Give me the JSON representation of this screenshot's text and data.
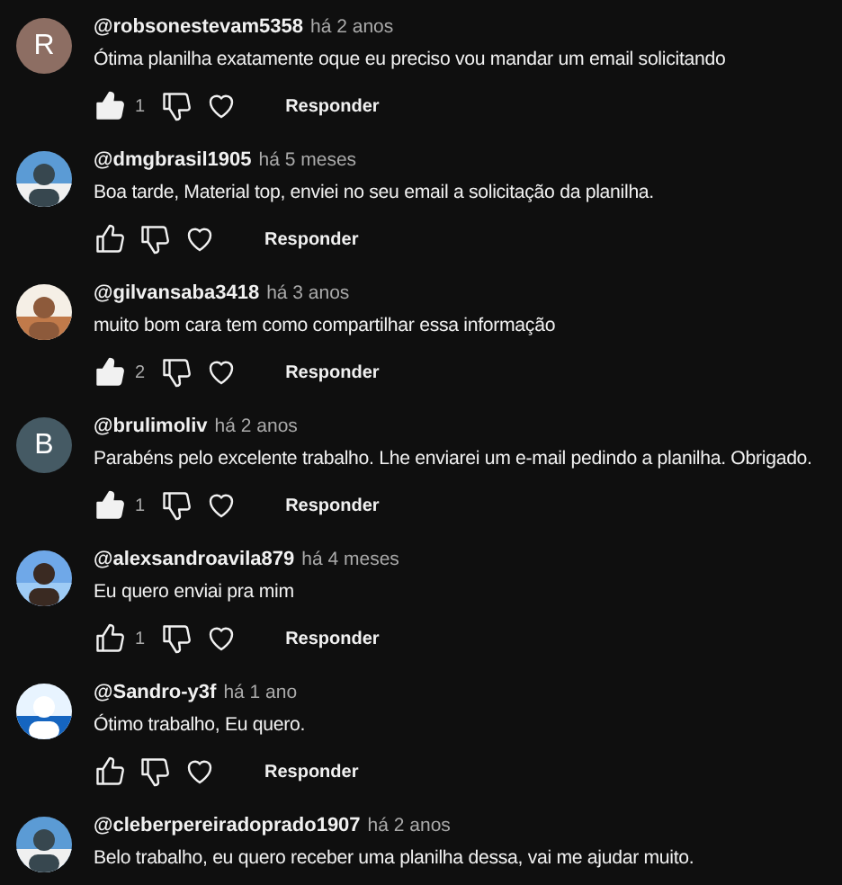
{
  "comments": [
    {
      "avatar": {
        "kind": "letter",
        "letter": "R",
        "color": "#8d6e63"
      },
      "author": "@robsonestevam5358",
      "time": "há 2 anos",
      "text": "Ótima planilha exatamente oque eu preciso vou mandar um email solicitando",
      "liked": true,
      "likes": "1",
      "reply": "Responder"
    },
    {
      "author": "@dmgbrasil1905",
      "time": "há 5 meses",
      "text": "Boa tarde, Material top, enviei no seu email a solicitação da planilha.",
      "liked": false,
      "reply": "Responder"
    },
    {
      "author": "@gilvansaba3418",
      "time": "há 3 anos",
      "text": "muito bom cara  tem como compartilhar essa informação",
      "liked": true,
      "likes": "2",
      "reply": "Responder"
    },
    {
      "avatar": {
        "kind": "letter",
        "letter": "B",
        "color": "#455a64"
      },
      "author": "@brulimoliv",
      "time": "há 2 anos",
      "text": "Parabéns pelo excelente trabalho. Lhe enviarei um e-mail pedindo a planilha. Obrigado.",
      "liked": true,
      "likes": "1",
      "reply": "Responder"
    },
    {
      "author": "@alexsandroavila879",
      "time": "há 4 meses",
      "text": "Eu quero enviai pra mim",
      "liked": false,
      "likes": "1",
      "reply": "Responder"
    },
    {
      "author": "@Sandro-y3f",
      "time": "há 1 ano",
      "text": "Ótimo trabalho, Eu quero.",
      "liked": false,
      "reply": "Responder"
    },
    {
      "author": "@cleberpereiradoprado1907",
      "time": "há 2 anos",
      "text": "Belo trabalho, eu quero receber uma planilha dessa, vai me ajudar muito."
    }
  ]
}
